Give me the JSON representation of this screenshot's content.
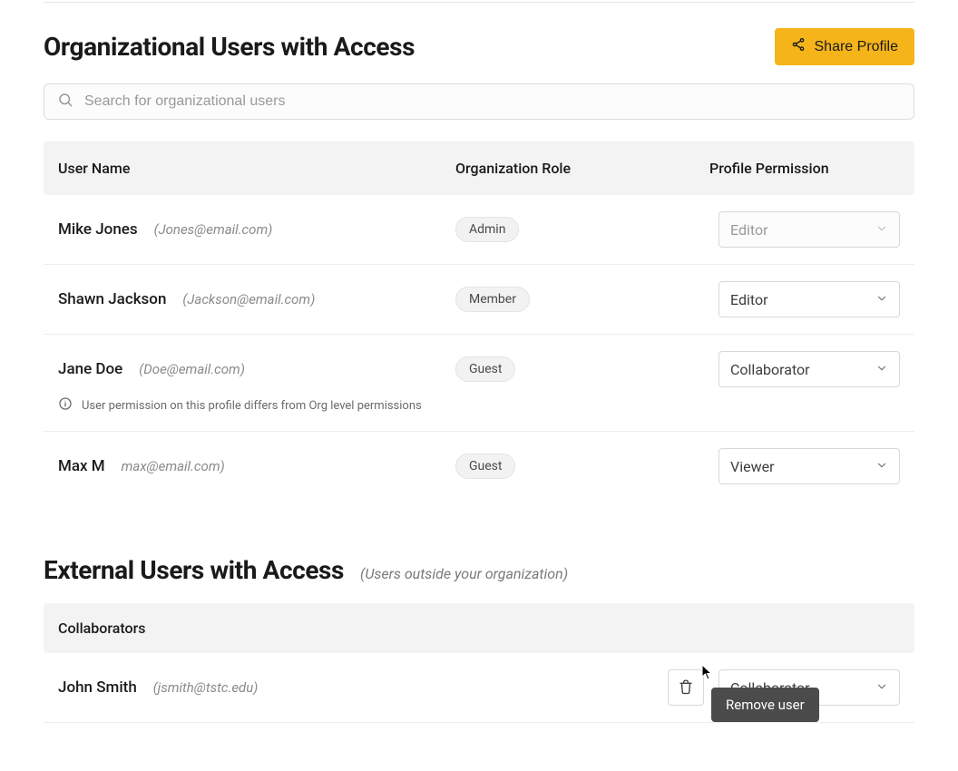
{
  "section1": {
    "title": "Organizational Users with Access",
    "share_button": "Share Profile",
    "search_placeholder": "Search for organizational users"
  },
  "columns": {
    "name": "User Name",
    "role": "Organization Role",
    "permission": "Profile Permission"
  },
  "users": [
    {
      "name": "Mike Jones",
      "email": "(Jones@email.com)",
      "role": "Admin",
      "permission": "Editor",
      "disabled": true
    },
    {
      "name": "Shawn Jackson",
      "email": "(Jackson@email.com)",
      "role": "Member",
      "permission": "Editor",
      "disabled": false
    },
    {
      "name": "Jane Doe",
      "email": "(Doe@email.com)",
      "role": "Guest",
      "permission": "Collaborator",
      "disabled": false,
      "warning": "User permission on this profile differs from Org level permissions"
    },
    {
      "name": "Max M",
      "email": "max@email.com)",
      "role": "Guest",
      "permission": "Viewer",
      "disabled": false
    }
  ],
  "section2": {
    "title": "External Users with Access",
    "subtitle": "(Users outside your organization)",
    "group_label": "Collaborators"
  },
  "external_users": [
    {
      "name": "John Smith",
      "email": "(jsmith@tstc.edu)",
      "permission": "Collaborator"
    }
  ],
  "tooltip": "Remove user"
}
